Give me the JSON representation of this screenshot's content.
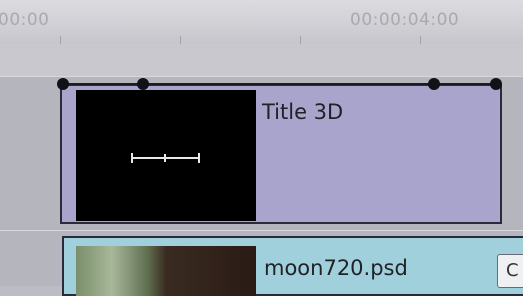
{
  "ruler": {
    "start_timecode": "00:00",
    "end_timecode": "00:00:04:00"
  },
  "clips": {
    "title": {
      "name": "Title 3D"
    },
    "moon": {
      "name": "moon720.psd",
      "badge": "C"
    }
  },
  "colors": {
    "title_clip": "#a8a4cc",
    "image_clip": "#9fd0dc",
    "keyframe": "#111118"
  }
}
